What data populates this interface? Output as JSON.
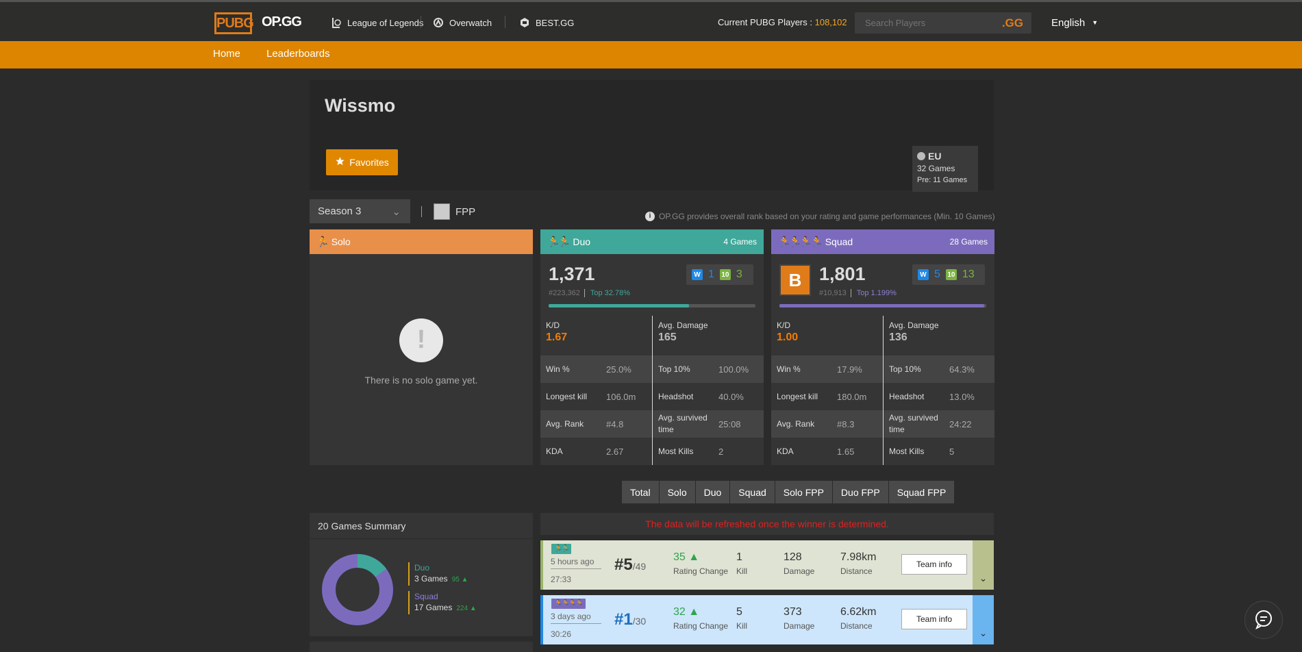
{
  "header": {
    "logo_pubg": "PUBG",
    "logo_opgg": "OP.GG",
    "nav": [
      "League of Legends",
      "Overwatch",
      "BEST.GG"
    ],
    "players_label": "Current PUBG Players : ",
    "players_count": "108,102",
    "search_placeholder": "Search Players",
    "search_brand": ".GG",
    "language": "English"
  },
  "subnav": {
    "home": "Home",
    "leaderboards": "Leaderboards"
  },
  "profile": {
    "name": "Wissmo",
    "favorites": "Favorites",
    "region": "EU",
    "games": "32 Games",
    "pre": "Pre: 11 Games"
  },
  "filters": {
    "season": "Season 3",
    "fpp": "FPP",
    "notice": "OP.GG provides overall rank based on your rating and game performances (Min. 10 Games)"
  },
  "solo": {
    "title": "Solo",
    "empty": "There is no solo game yet.",
    "mark": "!"
  },
  "duo": {
    "title": "Duo",
    "games": "4 Games",
    "rating": "1,371",
    "rank": "#223,362",
    "top": "Top 32.78%",
    "progress": 0.68,
    "wins": "1",
    "top10": "3",
    "kd_label": "K/D",
    "kd": "1.67",
    "dmg_label": "Avg. Damage",
    "dmg": "165",
    "rows": [
      {
        "l1": "Win %",
        "v1": "25.0%",
        "l2": "Top 10%",
        "v2": "100.0%"
      },
      {
        "l1": "Longest kill",
        "v1": "106.0m",
        "l2": "Headshot",
        "v2": "40.0%"
      },
      {
        "l1": "Avg. Rank",
        "v1": "#4.8",
        "l2": "Avg. survived time",
        "v2": "25:08"
      },
      {
        "l1": "KDA",
        "v1": "2.67",
        "l2": "Most Kills",
        "v2": "2"
      }
    ]
  },
  "squad": {
    "title": "Squad",
    "games": "28 Games",
    "rating": "1,801",
    "rank": "#10,913",
    "top": "Top 1.199%",
    "progress": 0.99,
    "emblem": "B",
    "wins": "5",
    "top10": "13",
    "kd_label": "K/D",
    "kd": "1.00",
    "dmg_label": "Avg. Damage",
    "dmg": "136",
    "rows": [
      {
        "l1": "Win %",
        "v1": "17.9%",
        "l2": "Top 10%",
        "v2": "64.3%"
      },
      {
        "l1": "Longest kill",
        "v1": "180.0m",
        "l2": "Headshot",
        "v2": "13.0%"
      },
      {
        "l1": "Avg. Rank",
        "v1": "#8.3",
        "l2": "Avg. survived time",
        "v2": "24:22"
      },
      {
        "l1": "KDA",
        "v1": "1.65",
        "l2": "Most Kills",
        "v2": "5"
      }
    ]
  },
  "badge_labels": {
    "win": "W",
    "top10": "10"
  },
  "match_tabs": [
    "Total",
    "Solo",
    "Duo",
    "Squad",
    "Solo FPP",
    "Duo FPP",
    "Squad FPP"
  ],
  "summary": {
    "title": "20 Games Summary",
    "duo": {
      "name": "Duo",
      "games": "3 Games",
      "delta": "95 ▲",
      "count": 3,
      "color": "#3fa89a"
    },
    "squad": {
      "name": "Squad",
      "games": "17 Games",
      "delta": "224 ▲",
      "count": 17,
      "color": "#7c6bbd"
    }
  },
  "refresh_notice": "The data will be refreshed once the winner is determined.",
  "matches": [
    {
      "mode_icon": "🏃🏃",
      "ago": "5 hours ago",
      "duration": "27:33",
      "rank": "#5",
      "of": "/49",
      "rating": "35 ▲",
      "rating_label": "Rating Change",
      "kill": "1",
      "kill_label": "Kill",
      "damage": "128",
      "damage_label": "Damage",
      "distance": "7.98km",
      "distance_label": "Distance",
      "team_btn": "Team info"
    },
    {
      "mode_icon": "🏃🏃🏃🏃",
      "ago": "3 days ago",
      "duration": "30:26",
      "rank": "#1",
      "of": "/30",
      "rating": "32 ▲",
      "rating_label": "Rating Change",
      "kill": "5",
      "kill_label": "Kill",
      "damage": "373",
      "damage_label": "Damage",
      "distance": "6.62km",
      "distance_label": "Distance",
      "team_btn": "Team info"
    }
  ],
  "colors": {
    "brand": "#e07b1a",
    "subnav": "#dd8500",
    "solo": "#e8904a",
    "duo": "#3fa89a",
    "squad": "#7c6bbd",
    "win_blue": "#1e88e5",
    "top10_green": "#7cb342"
  }
}
